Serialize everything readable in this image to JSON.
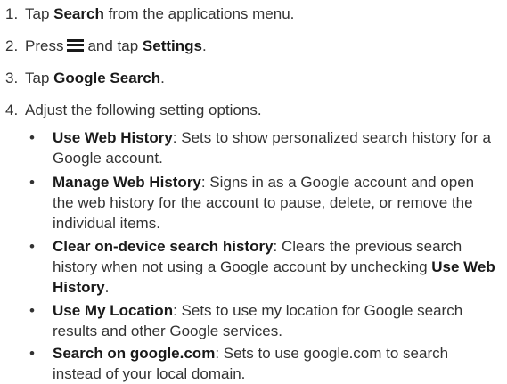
{
  "steps": [
    {
      "num": "1.",
      "pre": "Tap ",
      "bold": "Search",
      "post": " from the applications menu."
    },
    {
      "num": "2.",
      "pre": "Press",
      "mid": "and tap ",
      "bold": "Settings",
      "post": ".",
      "icon": "menu-icon"
    },
    {
      "num": "3.",
      "pre": "Tap ",
      "bold": "Google Search",
      "post": "."
    },
    {
      "num": "4.",
      "text": "Adjust the following setting options."
    }
  ],
  "options": [
    {
      "bullet": "•",
      "title": "Use Web History",
      "desc": ": Sets to show personalized search history for a Google account."
    },
    {
      "bullet": "•",
      "title": "Manage Web History",
      "desc": ": Signs in as a Google account and open the web history for the account to pause, delete, or remove the individual items."
    },
    {
      "bullet": "•",
      "title": "Clear on-device search history",
      "desc": ": Clears the previous search history when not using a Google account by unchecking ",
      "desc_bold": "Use Web History",
      "desc_end": "."
    },
    {
      "bullet": "•",
      "title": "Use My Location",
      "desc": ": Sets to use my location for Google search results and other Google services."
    },
    {
      "bullet": "•",
      "title": "Search on google.com",
      "desc": ": Sets to use google.com to search instead of your local domain."
    }
  ]
}
